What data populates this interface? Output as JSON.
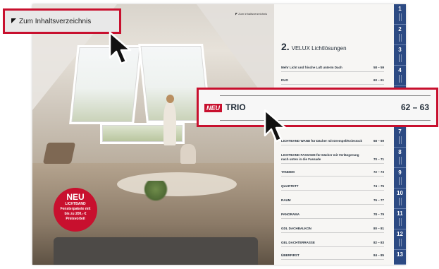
{
  "catalog": {
    "small_toc_link": "Zum Inhaltsverzeichnis",
    "badge": {
      "big": "NEU",
      "line1": "LICHTBAND",
      "line2": "Fensterpakete mit",
      "line3": "bis zu 200,- €",
      "line4": "Preisvorteil"
    },
    "section_number": "2.",
    "section_title": "VELUX Lichtlösungen",
    "toc_rows": [
      {
        "title": "Mehr Licht und frische Luft unterm Dach",
        "pages": "58 – 59"
      },
      {
        "title": "DUO",
        "pages": "60 – 61"
      },
      {
        "title": "LICHTBAND WAND für Dächer mit Drempel/Kniestock",
        "pages": "68 – 69"
      },
      {
        "title": "LICHTBAND FASSADE für Dächer mit Verlängerung nach unten in die Fassade",
        "pages": "70 – 71"
      },
      {
        "title": "TANDEM",
        "pages": "72 – 73"
      },
      {
        "title": "QUARTETT",
        "pages": "74 – 75"
      },
      {
        "title": "RAUM",
        "pages": "76 – 77"
      },
      {
        "title": "PANORAMA",
        "pages": "78 – 79"
      },
      {
        "title": "GDL DACHBALKON",
        "pages": "80 – 81"
      },
      {
        "title": "GEL DACHTERRASSE",
        "pages": "82 – 83"
      },
      {
        "title": "ÜBERFIRST",
        "pages": "84 – 85"
      }
    ],
    "chapter_tabs": [
      "1",
      "2",
      "3",
      "4",
      "5",
      "6",
      "7",
      "8",
      "9",
      "10",
      "11",
      "12",
      "13"
    ]
  },
  "callouts": {
    "toc_link": "Zum Inhaltsverzeichnis",
    "trio_badge": "NEU",
    "trio_name": "TRIO",
    "trio_pages": "62 – 63"
  },
  "colors": {
    "accent_red": "#c8102e",
    "tab_blue": "#2c4a83"
  }
}
